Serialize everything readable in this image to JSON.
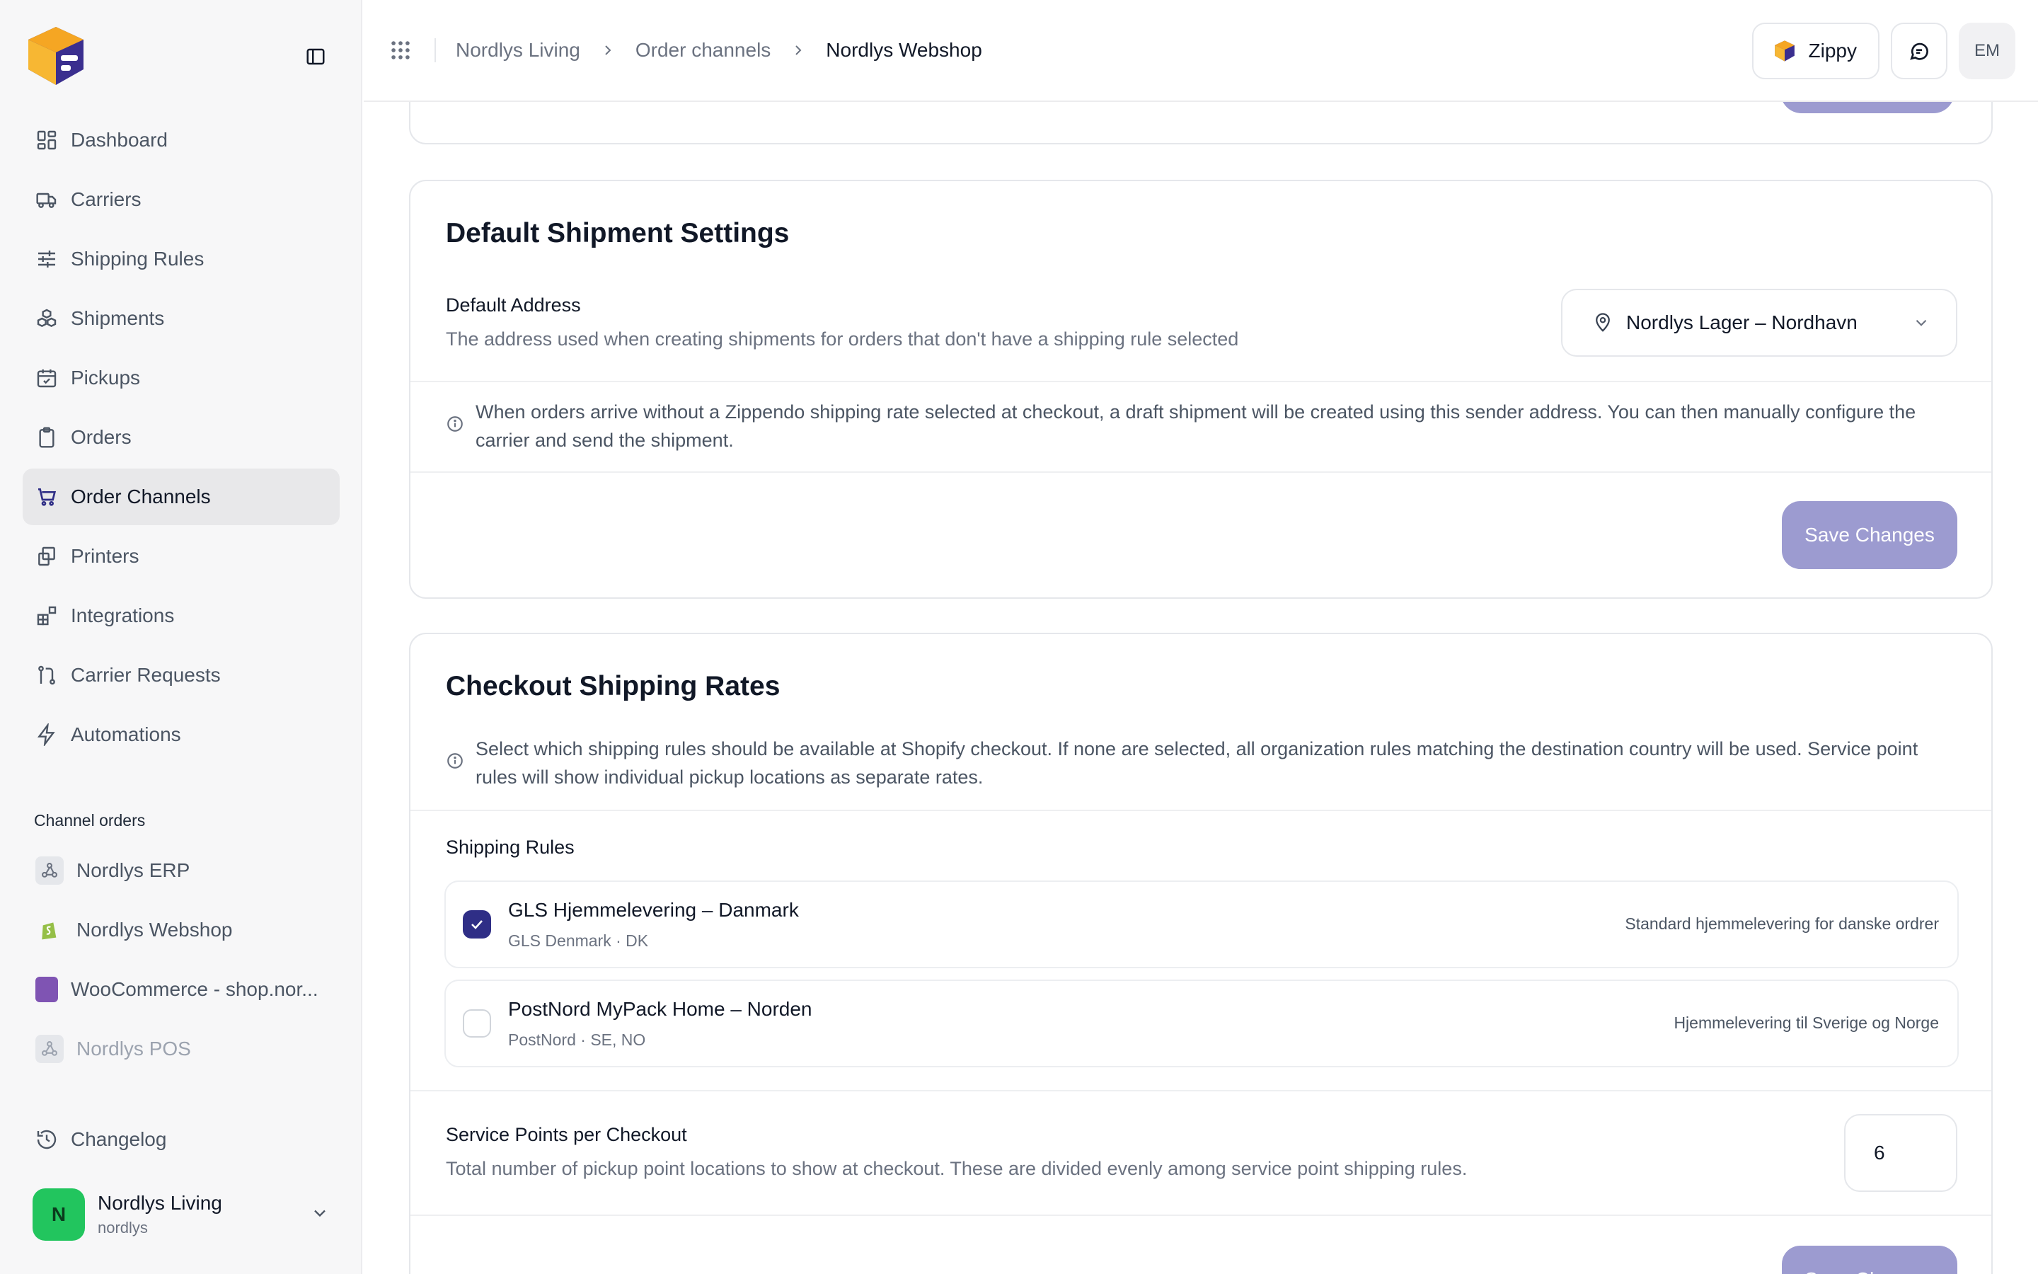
{
  "sidebar": {
    "nav": [
      {
        "label": "Dashboard",
        "icon": "dashboard-icon"
      },
      {
        "label": "Carriers",
        "icon": "truck-icon"
      },
      {
        "label": "Shipping Rules",
        "icon": "sliders-icon"
      },
      {
        "label": "Shipments",
        "icon": "boxes-icon"
      },
      {
        "label": "Pickups",
        "icon": "calendar-check-icon"
      },
      {
        "label": "Orders",
        "icon": "clipboard-icon"
      },
      {
        "label": "Order Channels",
        "icon": "cart-icon",
        "active": true
      },
      {
        "label": "Printers",
        "icon": "printer-icon"
      },
      {
        "label": "Integrations",
        "icon": "blocks-icon"
      },
      {
        "label": "Carrier Requests",
        "icon": "git-pull-icon"
      },
      {
        "label": "Automations",
        "icon": "zap-icon"
      }
    ],
    "channels_label": "Channel orders",
    "channels": [
      {
        "label": "Nordlys ERP",
        "icon": "webhook-icon"
      },
      {
        "label": "Nordlys Webshop",
        "icon": "shopify-icon"
      },
      {
        "label": "WooCommerce - shop.nor...",
        "icon": "woocommerce-icon"
      },
      {
        "label": "Nordlys POS",
        "icon": "webhook-icon",
        "muted": true
      }
    ],
    "changelog_label": "Changelog",
    "org": {
      "initial": "N",
      "name": "Nordlys Living",
      "slug": "nordlys"
    }
  },
  "topbar": {
    "breadcrumbs": [
      "Nordlys Living",
      "Order channels",
      "Nordlys Webshop"
    ],
    "zippy_label": "Zippy",
    "avatar_initials": "EM"
  },
  "default_shipment": {
    "title": "Default Shipment Settings",
    "address_label": "Default Address",
    "address_desc": "The address used when creating shipments for orders that don't have a shipping rule selected",
    "selected_address": "Nordlys Lager – Nordhavn",
    "info_text": "When orders arrive without a Zippendo shipping rate selected at checkout, a draft shipment will be created using this sender address. You can then manually configure the carrier and send the shipment.",
    "save_label": "Save Changes"
  },
  "checkout_rates": {
    "title": "Checkout Shipping Rates",
    "info_text": "Select which shipping rules should be available at Shopify checkout. If none are selected, all organization rules matching the destination country will be used. Service point rules will show individual pickup locations as separate rates.",
    "rules_label": "Shipping Rules",
    "rules": [
      {
        "name": "GLS Hjemmelevering – Danmark",
        "meta": "GLS Denmark · DK",
        "description": "Standard hjemmelevering for danske ordrer",
        "checked": true
      },
      {
        "name": "PostNord MyPack Home – Norden",
        "meta": "PostNord · SE, NO",
        "description": "Hjemmelevering til Sverige og Norge",
        "checked": false
      }
    ],
    "service_points_label": "Service Points per Checkout",
    "service_points_desc": "Total number of pickup point locations to show at checkout. These are divided evenly among service point shipping rules.",
    "service_points_value": "6"
  },
  "colors": {
    "accent": "#2f2e86",
    "button_disabled": "#9c9bd0",
    "org_avatar": "#22c55e"
  }
}
